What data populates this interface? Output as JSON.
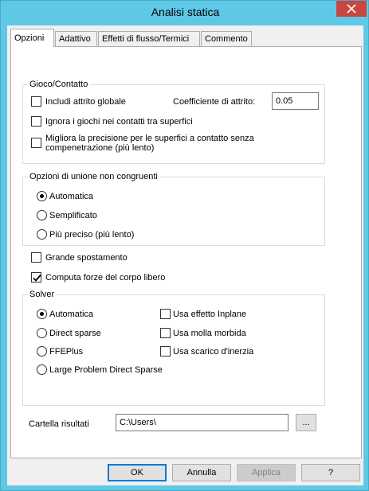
{
  "window": {
    "title": "Analisi statica"
  },
  "tabs": [
    {
      "label": "Opzioni",
      "active": true
    },
    {
      "label": "Adattivo",
      "active": false
    },
    {
      "label": "Effetti di flusso/Termici",
      "active": false
    },
    {
      "label": "Commento",
      "active": false
    }
  ],
  "gioco": {
    "legend": "Gioco/Contatto",
    "includi_label": "Includi attrito globale",
    "includi_checked": false,
    "coefficiente_label": "Coefficiente di attrito:",
    "coefficiente_value": "0.05",
    "ignora_label": "Ignora i giochi nei contatti tra superfici",
    "ignora_checked": false,
    "migliora_line1": "Migliora la precisione per le superfici a contatto senza",
    "migliora_line2": "compenetrazione (più lento)",
    "migliora_checked": false
  },
  "unione": {
    "legend": "Opzioni di unione non congruenti",
    "options": [
      "Automatica",
      "Semplificato",
      "Più preciso (più lento)"
    ],
    "selected": "Automatica"
  },
  "grande_spostamento": {
    "label": "Grande spostamento",
    "checked": false
  },
  "computa_forze": {
    "label": "Computa forze del corpo libero",
    "checked": true
  },
  "solver": {
    "legend": "Solver",
    "options": [
      "Automatica",
      "Direct sparse",
      "FFEPlus",
      "Large Problem Direct Sparse"
    ],
    "selected": "Automatica",
    "checks": [
      {
        "label": "Usa effetto Inplane",
        "checked": false
      },
      {
        "label": "Usa molla morbida",
        "checked": false
      },
      {
        "label": "Usa scarico d'inerzia",
        "checked": false
      }
    ]
  },
  "cartella": {
    "label": "Cartella risultati",
    "value": "C:\\Users\\",
    "browse_label": "..."
  },
  "buttons": {
    "ok": "OK",
    "annulla": "Annulla",
    "applica": "Applica",
    "help": "?"
  },
  "colors": {
    "title_bar": "#5fc8e6",
    "close_button": "#c7463f",
    "default_button_border": "#0078d7"
  }
}
